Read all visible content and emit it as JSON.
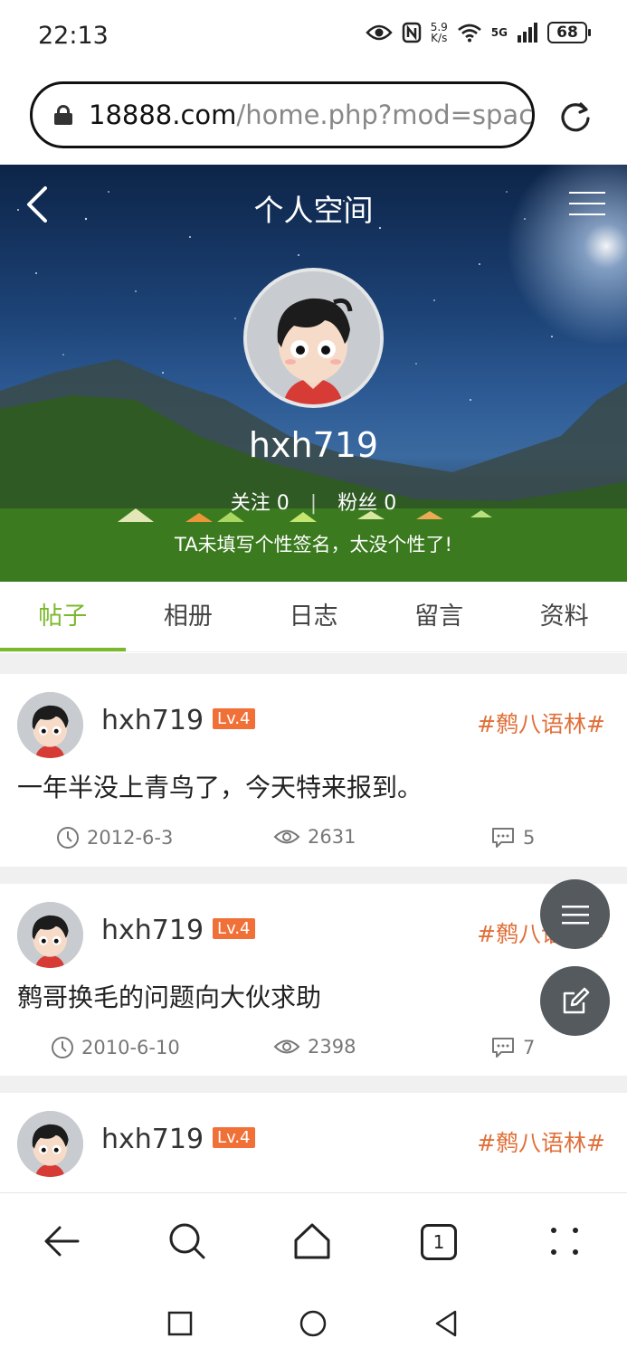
{
  "status": {
    "time": "22:13",
    "speed_value": "5.9",
    "speed_unit": "K/s",
    "network": "5G",
    "battery": "68"
  },
  "browser": {
    "url_domain": "18888.com",
    "url_path": "/home.php?mod=space",
    "tab_count": "1"
  },
  "header": {
    "title": "个人空间"
  },
  "profile": {
    "username": "hxh719",
    "follow_label": "关注",
    "follow_count": "0",
    "fans_label": "粉丝",
    "fans_count": "0",
    "signature": "TA未填写个性签名，太没个性了!"
  },
  "tabs": [
    {
      "label": "帖子",
      "active": true
    },
    {
      "label": "相册",
      "active": false
    },
    {
      "label": "日志",
      "active": false
    },
    {
      "label": "留言",
      "active": false
    },
    {
      "label": "资料",
      "active": false
    }
  ],
  "posts": [
    {
      "author": "hxh719",
      "level": "Lv.4",
      "tag": "#鹩八语林#",
      "title": "一年半没上青鸟了，今天特来报到。",
      "date": "2012-6-3",
      "views": "2631",
      "replies": "5"
    },
    {
      "author": "hxh719",
      "level": "Lv.4",
      "tag": "#鹩八语林#",
      "title": "鹩哥换毛的问题向大伙求助",
      "date": "2010-6-10",
      "views": "2398",
      "replies": "7"
    },
    {
      "author": "hxh719",
      "level": "Lv.4",
      "tag": "#鹩八语林#"
    }
  ],
  "colors": {
    "accent": "#7ab92b",
    "tag": "#e0703a",
    "level_badge": "#f07038",
    "fab": "#555a5e"
  }
}
